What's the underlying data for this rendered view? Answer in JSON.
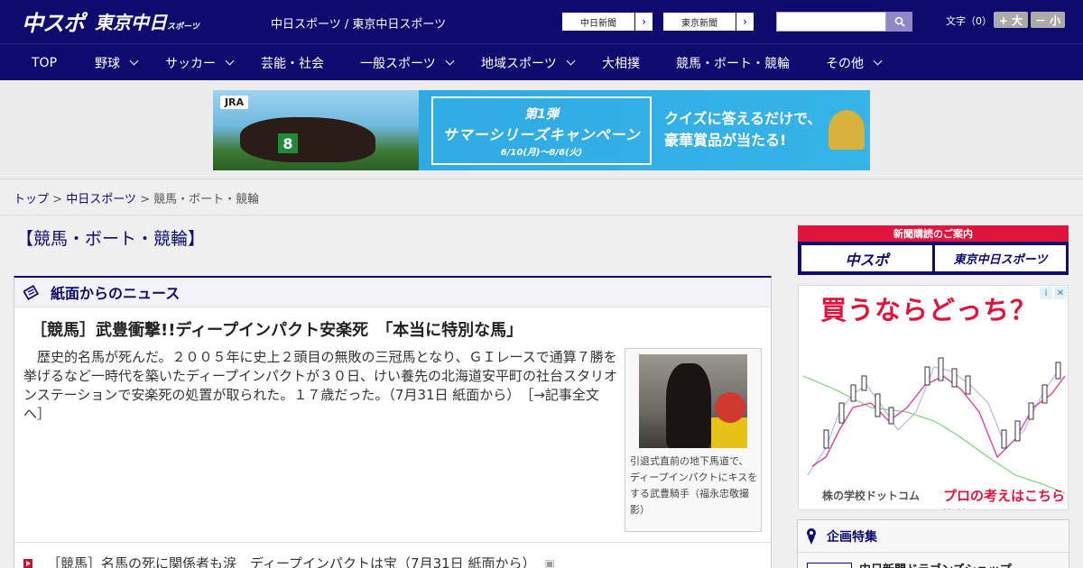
{
  "header": {
    "logo_chuspo": "中スポ",
    "logo_tokyo": "東京中日",
    "logo_tokyo_suffix": "スポーツ",
    "site_links": "中日スポーツ / 東京中日スポーツ",
    "ext_chunichi": "中日新聞",
    "ext_tokyo": "東京新聞",
    "search_placeholder": "",
    "fontsize_label": "文字（0）",
    "font_larger": "+ 大",
    "font_smaller": "－ 小"
  },
  "nav": {
    "items": [
      {
        "label": "TOP"
      },
      {
        "label": "野球"
      },
      {
        "label": "サッカー"
      },
      {
        "label": "芸能・社会"
      },
      {
        "label": "一般スポーツ"
      },
      {
        "label": "地域スポーツ"
      },
      {
        "label": "大相撲"
      },
      {
        "label": "競馬・ボート・競輪"
      },
      {
        "label": "その他"
      }
    ]
  },
  "banner": {
    "jra": "JRA",
    "campaign_line1": "第1弾",
    "campaign_line2": "サマーシリーズキャンペーン",
    "campaign_dates": "6/10(月)～8/6(火)",
    "right_line1": "クイズに答えるだけで、",
    "right_line2": "豪華賞品が当たる!"
  },
  "breadcrumb": {
    "home": "トップ",
    "sep1": " > ",
    "section": "中日スポーツ",
    "sep2": " > ",
    "current": "競馬・ボート・競輪"
  },
  "page": {
    "title": "【競馬・ボート・競輪】"
  },
  "news": {
    "box_title": "紙面からのニュース",
    "headline": "［競馬］武豊衝撃!!ディープインパクト安楽死　「本当に特別な馬」",
    "body": "歴史的名馬が死んだ。２００５年に史上２頭目の無敗の三冠馬となり、ＧＩレースで通算７勝を挙げるなど一時代を築いたディープインパクトが３０日、けい養先の北海道安平町の社台スタリオンステーションで安楽死の処置が取られた。１７歳だった。（7月31日 紙面から）　［→記事全文へ］",
    "photo_caption": "引退式直前の地下馬道で、ディープインパクトにキスをする武豊騎手（福永忠敬撮影）",
    "sub_item": "［競馬］名馬の死に関係者も涙　ディープインパクトは宝（7月31日 紙面から）"
  },
  "sidebar": {
    "subscribe_header": "新聞購読のご案内",
    "subscribe_chuspo": "中スポ",
    "subscribe_tokyo": "東京中日スポーツ",
    "ad_headline": "買うならどっち？",
    "ad_footer_left": "株の学校ドットコム",
    "ad_footer_right": "プロの考えはこちら≫≫",
    "kikaku_title": "企画特集",
    "kikaku_item": "中日新聞ドラゴンズショップ"
  },
  "colors": {
    "brand_navy": "#0f0a6e",
    "accent_red": "#e0143c"
  }
}
